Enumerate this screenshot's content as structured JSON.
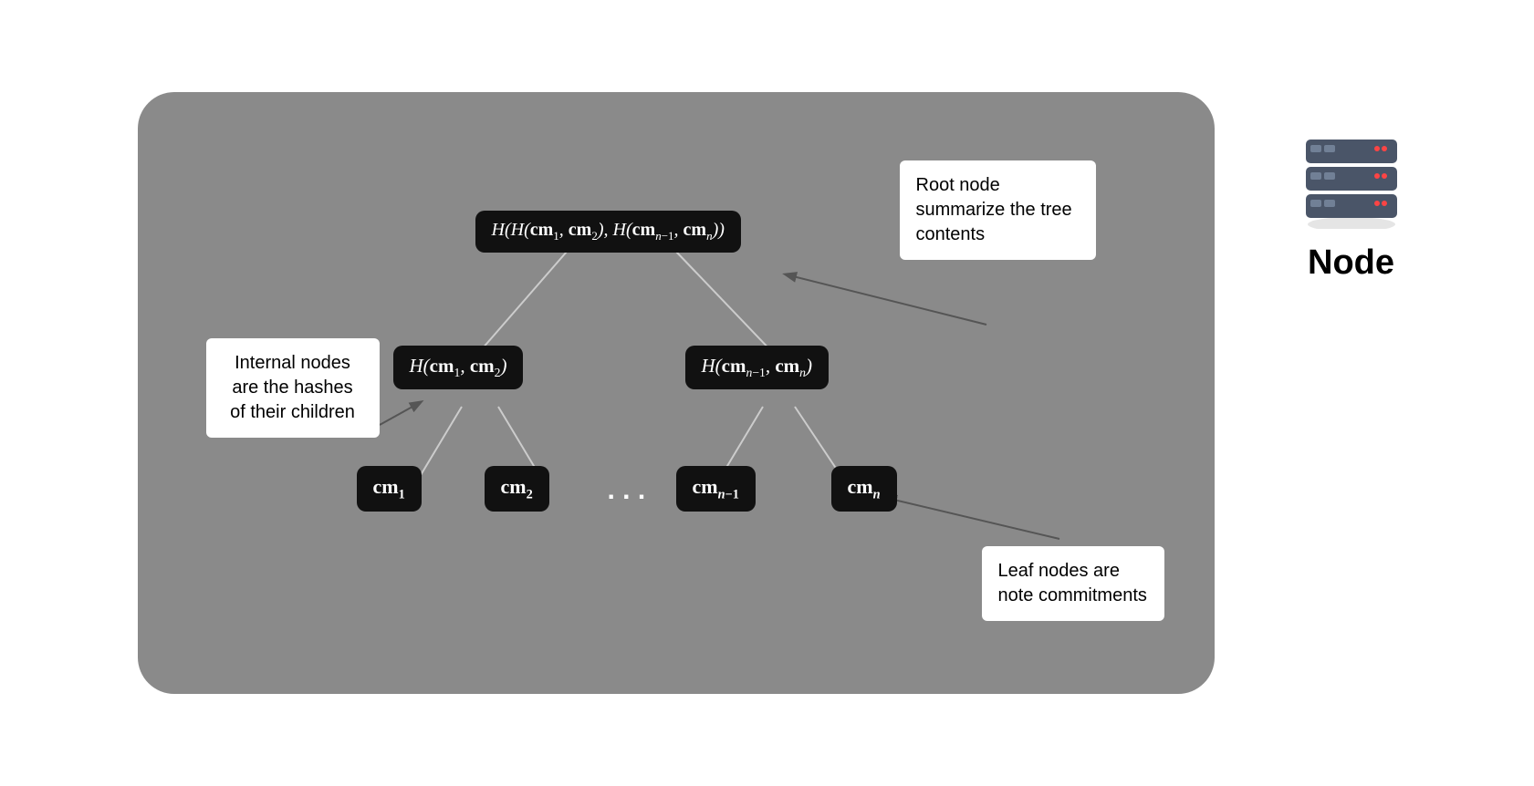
{
  "diagram": {
    "background_color": "#8a8a8a",
    "nodes": {
      "root": {
        "label": "H(H(cm₁, cm₂), H(cm_{n-1}, cm_n))",
        "display": "H(H(cm1,cm2), H(cmn-1,cmn))"
      },
      "left_internal": {
        "label": "H(cm₁, cm₂)",
        "display": "H(cm1, cm2)"
      },
      "right_internal": {
        "label": "H(cm_{n-1}, cm_n)",
        "display": "H(cmn-1, cmn)"
      },
      "leaf1": {
        "label": "cm₁",
        "display": "cm1"
      },
      "leaf2": {
        "label": "cm₂",
        "display": "cm2"
      },
      "leaf3": {
        "label": "cm_{n-1}",
        "display": "cmn-1"
      },
      "leaf4": {
        "label": "cm_n",
        "display": "cmn"
      }
    },
    "annotations": {
      "root_note": "Root node summarize the tree contents",
      "internal_note": "Internal nodes are the hashes of their children",
      "leaf_note": "Leaf nodes are note commitments"
    },
    "node_label": "Node"
  }
}
